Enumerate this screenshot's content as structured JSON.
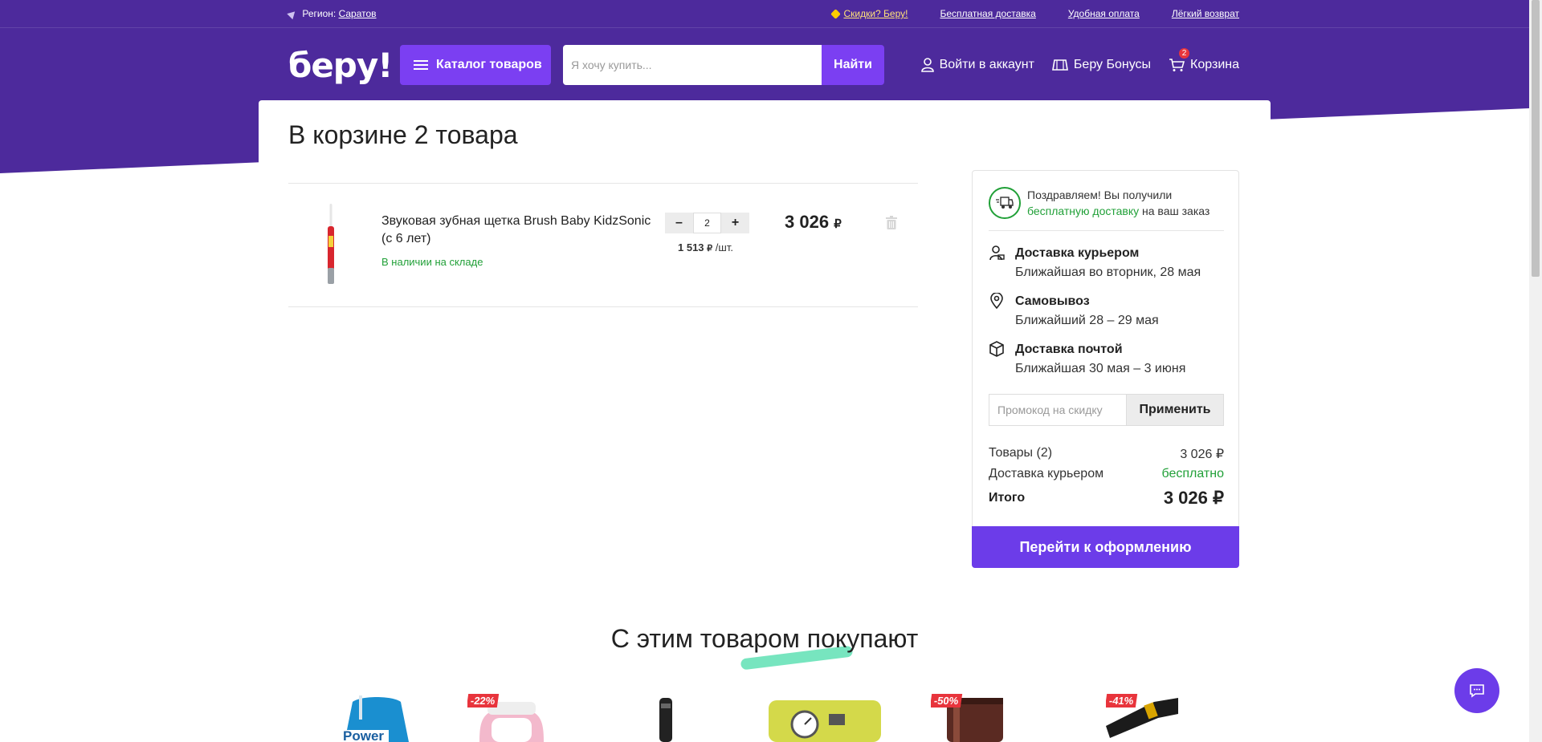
{
  "topbar": {
    "region_label": "Регион:",
    "region_value": "Саратов",
    "links": [
      "Скидки? Беру!",
      "Бесплатная доставка",
      "Удобная оплата",
      "Лёгкий возврат"
    ]
  },
  "header": {
    "logo": "беру!",
    "catalog_label": "Каталог товаров",
    "search_placeholder": "Я хочу купить...",
    "search_button": "Найти",
    "login_label": "Войти в аккаунт",
    "bonus_label": "Беру Бонусы",
    "cart_label": "Корзина",
    "cart_count": "2"
  },
  "cart": {
    "title": "В корзине 2 товара",
    "items": [
      {
        "name": "Звуковая зубная щетка Brush Baby KidzSonic (с 6 лет)",
        "stock": "В наличии на складе",
        "qty": "2",
        "unit_price": "1 513",
        "unit_suffix": "/шт.",
        "price": "3 026",
        "currency": "₽"
      }
    ]
  },
  "summary": {
    "congrats_text": "Поздравляем! Вы получили",
    "congrats_link": "бесплатную доставку",
    "congrats_suffix": "на ваш заказ",
    "options": [
      {
        "title": "Доставка курьером",
        "sub": "Ближайшая во вторник, 28 мая",
        "icon": "courier-icon"
      },
      {
        "title": "Самовывоз",
        "sub": "Ближайший 28 – 29 мая",
        "icon": "pin-icon"
      },
      {
        "title": "Доставка почтой",
        "sub": "Ближайшая 30 мая – 3 июня",
        "icon": "box-icon"
      }
    ],
    "promo_placeholder": "Промокод на скидку",
    "promo_button": "Применить",
    "goods_label": "Товары (2)",
    "goods_value": "3 026 ₽",
    "delivery_label": "Доставка курьером",
    "delivery_value": "бесплатно",
    "total_label": "Итого",
    "total_value": "3 026 ₽",
    "checkout_label": "Перейти к оформлению"
  },
  "also_bought": {
    "title": "С этим товаром покупают",
    "products": [
      {
        "badge": "",
        "label": "Power"
      },
      {
        "badge": "-22%"
      },
      {
        "badge": ""
      },
      {
        "badge": ""
      },
      {
        "badge": "-50%"
      },
      {
        "badge": "-41%"
      }
    ]
  },
  "colors": {
    "brand_purple": "#4d2a9c",
    "accent_violet": "#6c3ce9",
    "success_green": "#21a038",
    "sale_red": "#e8343c"
  }
}
